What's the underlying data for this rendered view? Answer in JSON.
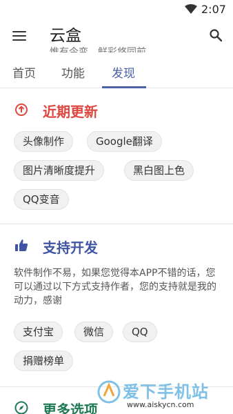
{
  "status_bar": {
    "time": "2:07",
    "wifi_icon": "wifi-icon"
  },
  "app_bar": {
    "title": "云盒",
    "subtitle": "惟有今变，鲜彩悠同前",
    "menu_icon": "hamburger-menu-icon",
    "search_icon": "search-icon"
  },
  "tabs": [
    {
      "label": "首页",
      "active": false
    },
    {
      "label": "功能",
      "active": false
    },
    {
      "label": "发现",
      "active": true
    }
  ],
  "sections": {
    "recent": {
      "title": "近期更新",
      "icon": "arrow-up-circle-icon",
      "color": "#e0463e",
      "chips": [
        "头像制作",
        "Google翻译",
        "图片清晰度提升",
        "黑白图上色",
        "QQ变音"
      ]
    },
    "support": {
      "title": "支持开发",
      "icon": "thumbs-up-icon",
      "color": "#3f54a3",
      "description": "软件制作不易，如果您觉得本APP不错的话，您可以通过以下方式支持作者，您的支持就是我的动力，感谢",
      "chips": [
        "支付宝",
        "微信",
        "QQ",
        "捐赠榜单"
      ]
    },
    "more": {
      "title": "更多选项",
      "icon": "compass-icon",
      "color": "#1f7a55"
    }
  },
  "watermark": {
    "text": "爱下手机站",
    "url": "www.aiskycn.com"
  },
  "colors": {
    "accent": "#4a5fa8",
    "chip_bg": "#f1f1f1"
  }
}
